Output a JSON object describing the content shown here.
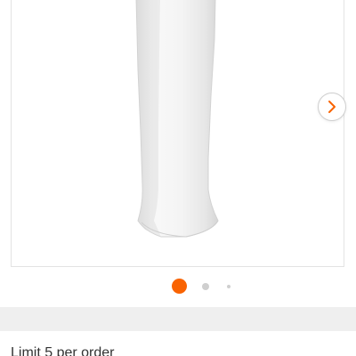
{
  "product_gallery": {
    "image_alt": "White pedestal sink base",
    "next_icon": "chevron-right-icon",
    "active_page": 1,
    "page_count": 3
  },
  "pagination": {
    "active_color": "#f96302",
    "inactive_color": "#cfcfcf"
  },
  "purchase_info": {
    "limit_text": "Limit 5 per order"
  },
  "colors": {
    "accent": "#f96302",
    "divider": "#efefef",
    "card_border": "#e3e3e3"
  }
}
